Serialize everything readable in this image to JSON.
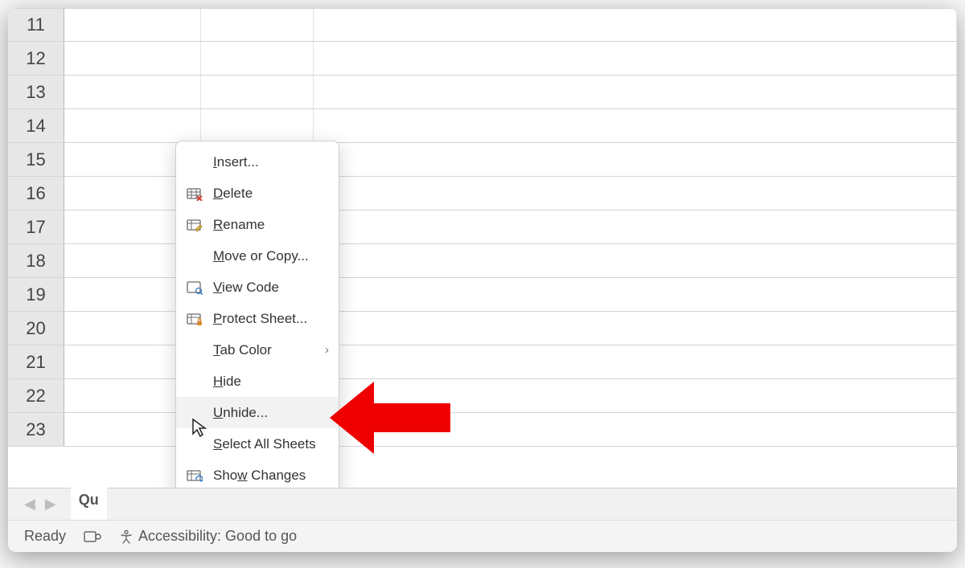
{
  "rows": [
    "11",
    "12",
    "13",
    "14",
    "15",
    "16",
    "17",
    "18",
    "19",
    "20",
    "21",
    "22",
    "23"
  ],
  "tab_strip": {
    "sheet_label_visible": "Qu"
  },
  "status_bar": {
    "ready": "Ready",
    "accessibility": "Accessibility: Good to go"
  },
  "context_menu": {
    "items": [
      {
        "label_pre": "",
        "ul": "I",
        "label_post": "nsert...",
        "icon": ""
      },
      {
        "label_pre": "",
        "ul": "D",
        "label_post": "elete",
        "icon": "delete"
      },
      {
        "label_pre": "",
        "ul": "R",
        "label_post": "ename",
        "icon": "rename"
      },
      {
        "label_pre": "",
        "ul": "M",
        "label_post": "ove or Copy...",
        "icon": ""
      },
      {
        "label_pre": "",
        "ul": "V",
        "label_post": "iew Code",
        "icon": "view-code"
      },
      {
        "label_pre": "",
        "ul": "P",
        "label_post": "rotect Sheet...",
        "icon": "protect"
      },
      {
        "label_pre": "",
        "ul": "T",
        "label_post": "ab Color",
        "icon": "",
        "submenu": true
      },
      {
        "label_pre": "",
        "ul": "H",
        "label_post": "ide",
        "icon": ""
      },
      {
        "label_pre": "",
        "ul": "U",
        "label_post": "nhide...",
        "icon": "",
        "highlight": true
      },
      {
        "label_pre": "",
        "ul": "S",
        "label_post": "elect All Sheets",
        "icon": ""
      },
      {
        "label_pre": "Sho",
        "ul": "w",
        "label_post": " Changes",
        "icon": "show-changes"
      }
    ]
  }
}
